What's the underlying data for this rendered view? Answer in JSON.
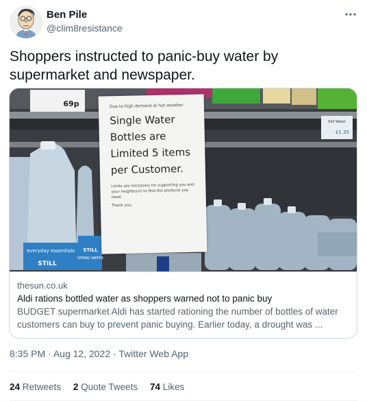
{
  "author": {
    "name": "Ben Pile",
    "handle": "@clim8resistance"
  },
  "more_icon": "more-horizontal-icon",
  "tweet_text": "Shoppers instructed to panic-buy water by supermarket and newspaper.",
  "card": {
    "image": {
      "sign_small": "Due to high demand at hot weather",
      "sign_big": "Single Water Bottles are Limited 5 items per Customer.",
      "sign_foot": "Limits are necessary for supporting you and your neighbours to find the products you need.",
      "sign_thanks": "Thank you.",
      "price": "69p",
      "price_right": "£1.35",
      "bottle_label": "everyday essentials",
      "bottle_still": "STILL",
      "bottle_still2": "STILL",
      "bottle_spring": "SPRING WATER"
    },
    "domain": "thesun.co.uk",
    "title": "Aldi rations bottled water as shoppers warned not to panic buy",
    "description": "BUDGET supermarket Aldi has started rationing the number of bottles of water customers can buy to prevent panic buying. Earlier today, a drought was ..."
  },
  "meta": {
    "time": "8:35 PM",
    "date": "Aug 12, 2022",
    "source": "Twitter Web App",
    "separator": "·"
  },
  "stats": {
    "retweets_count": "24",
    "retweets_label": "Retweets",
    "quotes_count": "2",
    "quotes_label": "Quote Tweets",
    "likes_count": "74",
    "likes_label": "Likes"
  }
}
